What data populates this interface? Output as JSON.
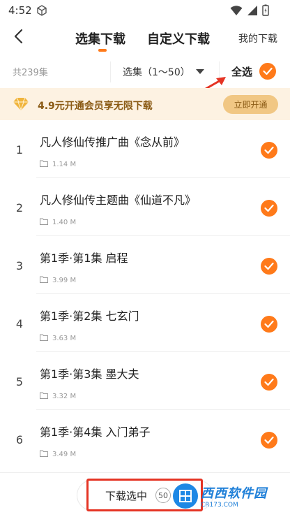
{
  "status_bar": {
    "time": "4:52"
  },
  "header": {
    "tabs": [
      {
        "label": "选集下载"
      },
      {
        "label": "自定义下载"
      }
    ],
    "my_downloads": "我的下载"
  },
  "filter": {
    "total": "共239集",
    "range": "选集（1～50）",
    "select_all": "全选"
  },
  "vip_banner": {
    "text": "4.9元开通会员享无限下载",
    "button": "立即开通"
  },
  "episodes": [
    {
      "number": "1",
      "title": "凡人修仙传推广曲《念从前》",
      "size": "1.14 M"
    },
    {
      "number": "2",
      "title": "凡人修仙传主题曲《仙道不凡》",
      "size": "1.40 M"
    },
    {
      "number": "3",
      "title": "第1季·第1集 启程",
      "size": "3.99 M"
    },
    {
      "number": "4",
      "title": "第1季·第2集 七玄门",
      "size": "3.63 M"
    },
    {
      "number": "5",
      "title": "第1季·第3集 墨大夫",
      "size": "3.32 M"
    },
    {
      "number": "6",
      "title": "第1季·第4集 入门弟子",
      "size": "3.49 M"
    }
  ],
  "bottom_bar": {
    "download_label": "下载选中",
    "selected_count": "50"
  },
  "watermark": {
    "brand": "西西软件园",
    "site": "CR173.COM"
  },
  "colors": {
    "accent": "#ff7a1a",
    "vip_background": "#fdf2e2",
    "vip_text": "#8a5a14",
    "annotation_red": "#e53424"
  },
  "icons": {
    "back": "chevron-left-icon",
    "dropdown": "caret-down-icon",
    "check": "check-circle-icon",
    "folder": "folder-icon",
    "vip": "diamond-icon"
  }
}
